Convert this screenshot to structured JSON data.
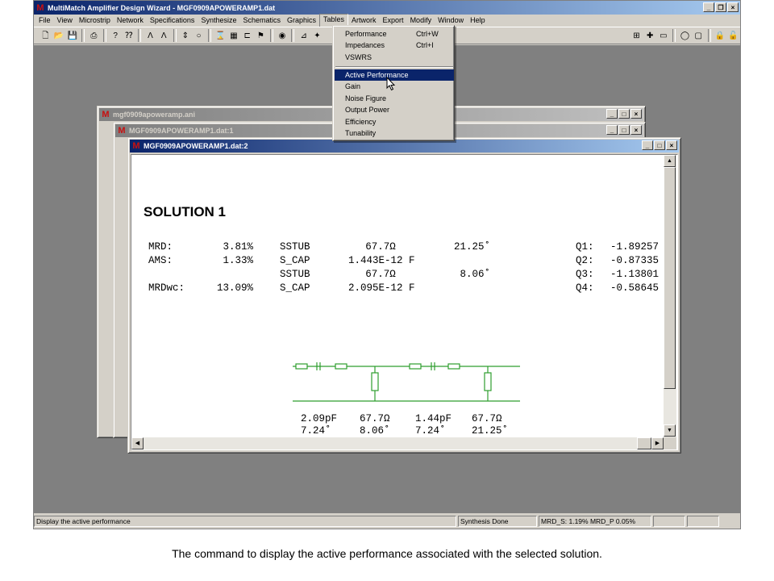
{
  "app": {
    "title": "MultiMatch Amplifier Design Wizard - MGF0909APOWERAMP1.dat",
    "icon": "M",
    "window_buttons": [
      "_",
      "❐",
      "×"
    ]
  },
  "menubar": [
    "File",
    "View",
    "Microstrip",
    "Network",
    "Specifications",
    "Synthesize",
    "Schematics",
    "Graphics",
    "Tables",
    "Artwork",
    "Export",
    "Modify",
    "Window",
    "Help"
  ],
  "tables_menu": {
    "group1": [
      {
        "label": "Performance",
        "shortcut": "Ctrl+W"
      },
      {
        "label": "Impedances",
        "shortcut": "Ctrl+I"
      },
      {
        "label": "VSWRS",
        "shortcut": ""
      }
    ],
    "group2": [
      {
        "label": "Active Performance",
        "highlighted": true
      },
      {
        "label": "Gain"
      },
      {
        "label": "Noise Figure"
      },
      {
        "label": "Output Power"
      },
      {
        "label": "Efficiency"
      },
      {
        "label": "Tunability"
      }
    ]
  },
  "windows": {
    "win1_title": "mgf0909apoweramp.ani",
    "win2_title": "MGF0909APOWERAMP1.dat:1",
    "win3_title": "MGF0909APOWERAMP1.dat:2",
    "mini_buttons": [
      "_",
      "□",
      "×"
    ]
  },
  "solution": {
    "heading": "SOLUTION 1",
    "rows": [
      [
        "MRD:",
        "3.81%",
        "SSTUB",
        "67.7Ω",
        "21.25˚",
        "Q1:",
        "-1.89257"
      ],
      [
        "AMS:",
        "1.33%",
        "S_CAP",
        "1.443E-12 F",
        "",
        "Q2:",
        "-0.87335"
      ],
      [
        "",
        "",
        "SSTUB",
        "67.7Ω",
        "8.06˚",
        "Q3:",
        "-1.13801"
      ],
      [
        "MRDwc:",
        "13.09%",
        "S_CAP",
        "2.095E-12 F",
        "",
        "Q4:",
        "-0.58645"
      ]
    ],
    "schematic_labels_row1": [
      "2.09pF",
      "67.7Ω",
      "1.44pF",
      "67.7Ω"
    ],
    "schematic_labels_row2": [
      "7.24˚",
      "8.06˚",
      "7.24˚",
      "21.25˚"
    ],
    "schematic_color": "#2e9e2e"
  },
  "statusbar": {
    "message": "Display the active performance",
    "state": "Synthesis Done",
    "metrics": "MRD_S: 1.19% MRD_P 0.05%"
  },
  "caption": "The command to display the active performance associated with the selected solution.",
  "colors": {
    "active_title": "#0a246a",
    "highlight": "#0a246a",
    "face": "#d4d0c8",
    "workspace": "#808080"
  }
}
